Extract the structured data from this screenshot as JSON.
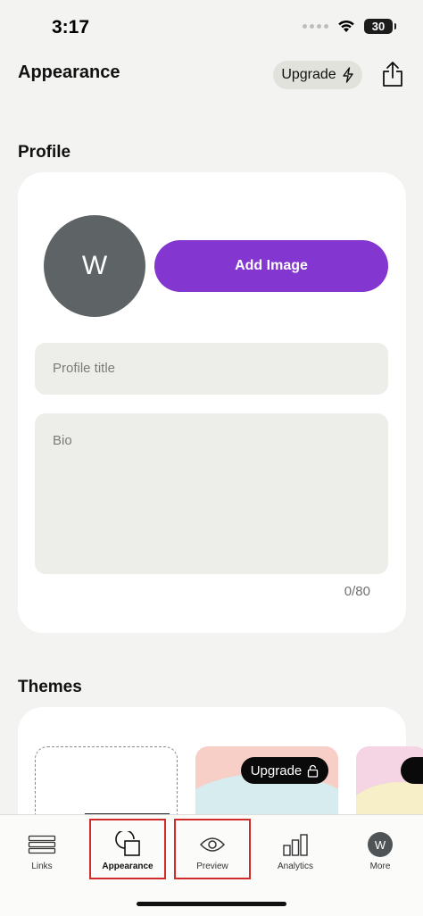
{
  "status_bar": {
    "time": "3:17",
    "battery": "30"
  },
  "header": {
    "title": "Appearance",
    "upgrade_label": "Upgrade"
  },
  "profile": {
    "section_title": "Profile",
    "avatar_initial": "W",
    "add_image_label": "Add Image",
    "title_placeholder": "Profile title",
    "bio_placeholder": "Bio",
    "char_count": "0/80"
  },
  "themes": {
    "section_title": "Themes",
    "upgrade_label": "Upgrade"
  },
  "tab_bar": {
    "tabs": [
      {
        "label": "Links",
        "icon": "links-icon"
      },
      {
        "label": "Appearance",
        "icon": "appearance-icon"
      },
      {
        "label": "Preview",
        "icon": "eye-icon"
      },
      {
        "label": "Analytics",
        "icon": "bar-chart-icon"
      },
      {
        "label": "More",
        "icon": "avatar"
      }
    ],
    "more_initial": "W"
  },
  "colors": {
    "accent": "#8436d1",
    "avatar_bg": "#5e6466",
    "highlight_border": "#d12c2c",
    "page_bg": "#f3f3f1"
  }
}
